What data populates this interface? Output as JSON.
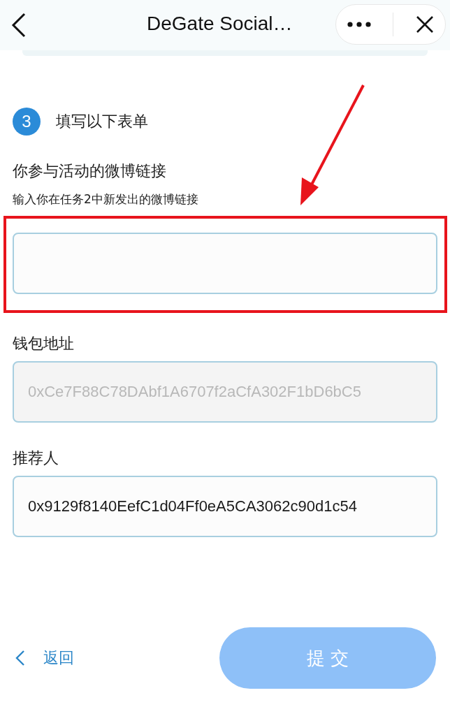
{
  "header": {
    "title": "DeGate Social…"
  },
  "step": {
    "number": "3",
    "title": "填写以下表单"
  },
  "fields": [
    {
      "label": "你参与活动的微博链接",
      "hint": "输入你在任务2中新发出的微博链接",
      "disabled": false,
      "highlighted": true
    },
    {
      "label": "钱包地址",
      "value": "0xCe7F88C78DAbf1A6707f2aCfA302F1bD6bC5",
      "disabled": true,
      "highlighted": false
    },
    {
      "label": "推荐人",
      "value": "0x9129f8140EefC1d04Ff0eA5CA3062c90d1c54",
      "disabled": false,
      "highlighted": false
    }
  ],
  "back_link": "返回",
  "submit": {
    "label": "提 交",
    "disabled": true
  }
}
